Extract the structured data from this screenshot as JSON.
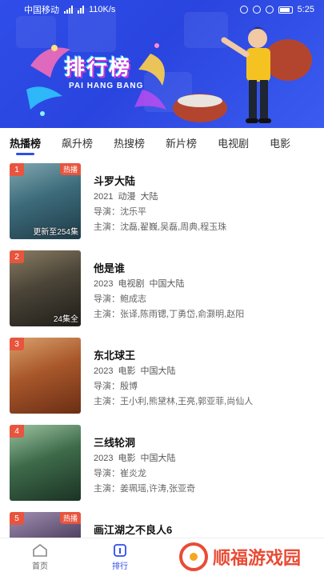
{
  "status_bar": {
    "carrier": "中国移动",
    "speed": "110K/s",
    "time": "5:25"
  },
  "banner": {
    "title": "排行榜",
    "subtitle": "PAI HANG BANG"
  },
  "tabs": [
    {
      "label": "热播榜",
      "active": true
    },
    {
      "label": "飙升榜",
      "active": false
    },
    {
      "label": "热搜榜",
      "active": false
    },
    {
      "label": "新片榜",
      "active": false
    },
    {
      "label": "电视剧",
      "active": false
    },
    {
      "label": "电影",
      "active": false
    }
  ],
  "items": [
    {
      "rank": "1",
      "badge": "热播",
      "poster_note": "更新至254集",
      "title": "斗罗大陆",
      "year": "2021",
      "type": "动漫",
      "region": "大陆",
      "director": "导演：沈乐平",
      "cast": "主演：沈磊,翟巍,吴磊,周典,程玉珠",
      "poster_colors": [
        "#3d6b7a",
        "#1e3b48",
        "#7fa7b0"
      ]
    },
    {
      "rank": "2",
      "badge": "",
      "poster_note": "24集全",
      "title": "他是谁",
      "year": "2023",
      "type": "电视剧",
      "region": "中国大陆",
      "director": "导演：鲍成志",
      "cast": "主演：张译,陈雨锶,丁勇岱,俞灏明,赵阳",
      "poster_colors": [
        "#4a4438",
        "#201d18",
        "#8a7c62"
      ]
    },
    {
      "rank": "3",
      "badge": "",
      "poster_note": "",
      "title": "东北球王",
      "year": "2023",
      "type": "电影",
      "region": "中国大陆",
      "director": "导演：殷博",
      "cast": "主演：王小利,熊黛林,王亮,郭亚菲,尚仙人",
      "poster_colors": [
        "#a8572b",
        "#6b2e14",
        "#d9a06a"
      ]
    },
    {
      "rank": "4",
      "badge": "",
      "poster_note": "",
      "title": "三线轮洞",
      "year": "2023",
      "type": "电影",
      "region": "中国大陆",
      "director": "导演：崔炎龙",
      "cast": "主演：姜珮瑶,许涛,张亚奇",
      "poster_colors": [
        "#3e6a4a",
        "#1b3324",
        "#9bc3a0"
      ]
    },
    {
      "rank": "5",
      "badge": "热播",
      "poster_note": "",
      "title": "画江湖之不良人6",
      "year": "",
      "type": "",
      "region": "",
      "director": "",
      "cast": "",
      "poster_colors": [
        "#5a4a6a",
        "#2a2235",
        "#a08fb3"
      ]
    }
  ],
  "bottom_nav": [
    {
      "label": "首页",
      "icon": "home-icon",
      "active": false
    },
    {
      "label": "排行",
      "icon": "ranking-icon",
      "active": true
    }
  ],
  "watermark": {
    "text": "顺福游戏园"
  },
  "colors": {
    "accent": "#2f4de8",
    "rank_badge": "#e8553e",
    "watermark": "#e94b35"
  }
}
